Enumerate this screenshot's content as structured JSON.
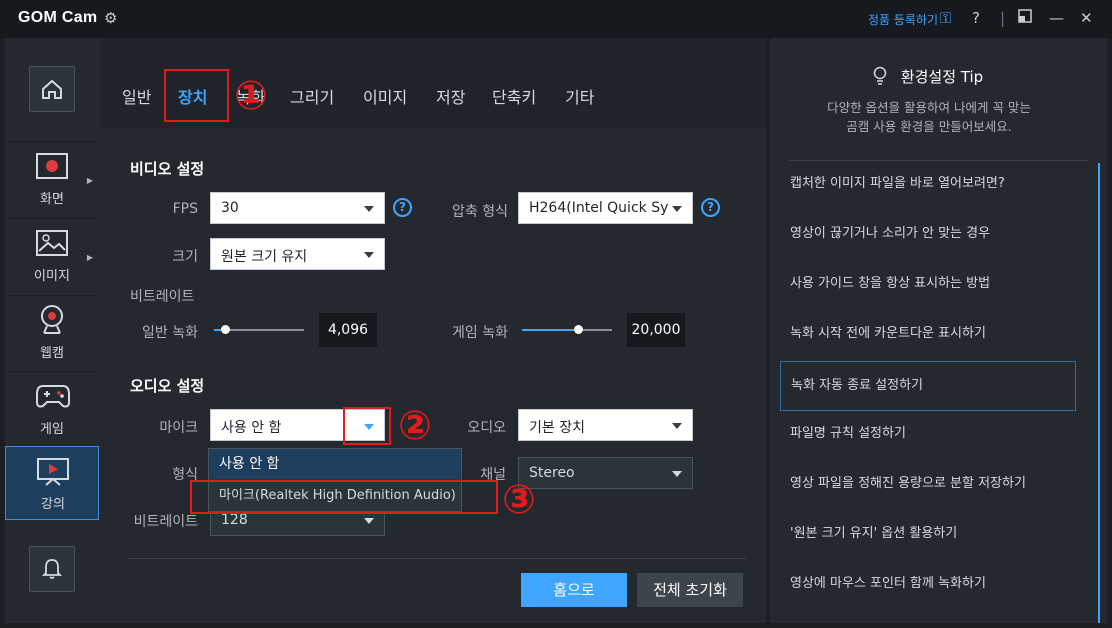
{
  "app": {
    "logo": "GOM Cam",
    "register_label": "정품 등록하기",
    "help_label": "?",
    "minimize_label": "—",
    "close_label": "✕"
  },
  "leftbar": {
    "items": [
      {
        "label": "화면",
        "icon": "screen-record-icon"
      },
      {
        "label": "이미지",
        "icon": "image-icon"
      },
      {
        "label": "웹캠",
        "icon": "webcam-icon"
      },
      {
        "label": "게임",
        "icon": "gamepad-icon"
      },
      {
        "label": "강의",
        "icon": "lecture-icon",
        "active": true
      }
    ]
  },
  "tabs": [
    {
      "label": "일반"
    },
    {
      "label": "장치",
      "active": true
    },
    {
      "label": "녹화"
    },
    {
      "label": "그리기"
    },
    {
      "label": "이미지"
    },
    {
      "label": "저장"
    },
    {
      "label": "단축키"
    },
    {
      "label": "기타"
    }
  ],
  "annotations": [
    "①",
    "②",
    "③"
  ],
  "video": {
    "title": "비디오 설정",
    "fps_label": "FPS",
    "fps_value": "30",
    "codec_label": "압축 형식",
    "codec_value": "H264(Intel Quick Syn",
    "size_label": "크기",
    "size_value": "원본 크기 유지",
    "bitrate_label": "비트레이트",
    "normal_label": "일반 녹화",
    "normal_value": "4,096",
    "normal_level": 0.12,
    "game_label": "게임 녹화",
    "game_value": "20,000",
    "game_level": 0.62
  },
  "audio": {
    "title": "오디오 설정",
    "mic_label": "마이크",
    "mic_value": "사용 안 함",
    "audio_label": "오디오",
    "audio_value": "기본 장치",
    "format_label": "형식",
    "channel_label": "채널",
    "channel_value": "Stereo",
    "bitrate_label": "비트레이트",
    "bitrate_value": "128",
    "mic_options": [
      "사용 안 함",
      "마이크(Realtek High Definition Audio)"
    ]
  },
  "buttons": {
    "home": "홈으로",
    "reset": "전체 초기화"
  },
  "tips": {
    "title": "환경설정 Tip",
    "subtitle_line1": "다양한 옵션을 활용하여 나에게 꼭 맞는",
    "subtitle_line2": "곰캠 사용 환경을 만들어보세요.",
    "items": [
      "캡처한 이미지 파일을 바로 열어보려면?",
      "영상이 끊기거나 소리가 안 맞는 경우",
      "사용 가이드 창을 항상 표시하는 방법",
      "녹화 시작 전에 카운트다운 표시하기",
      "녹화 자동 종료 설정하기",
      "파일명 규칙 설정하기",
      "영상 파일을 정해진 용량으로 분할 저장하기",
      "'원본 크기 유지' 옵션 활용하기",
      "영상에 마우스 포인터 함께 녹화하기"
    ]
  },
  "colors": {
    "accent": "#3ea6ff",
    "annotation": "#e01b1b",
    "background": "#1b1f24",
    "panel": "#23292f"
  }
}
